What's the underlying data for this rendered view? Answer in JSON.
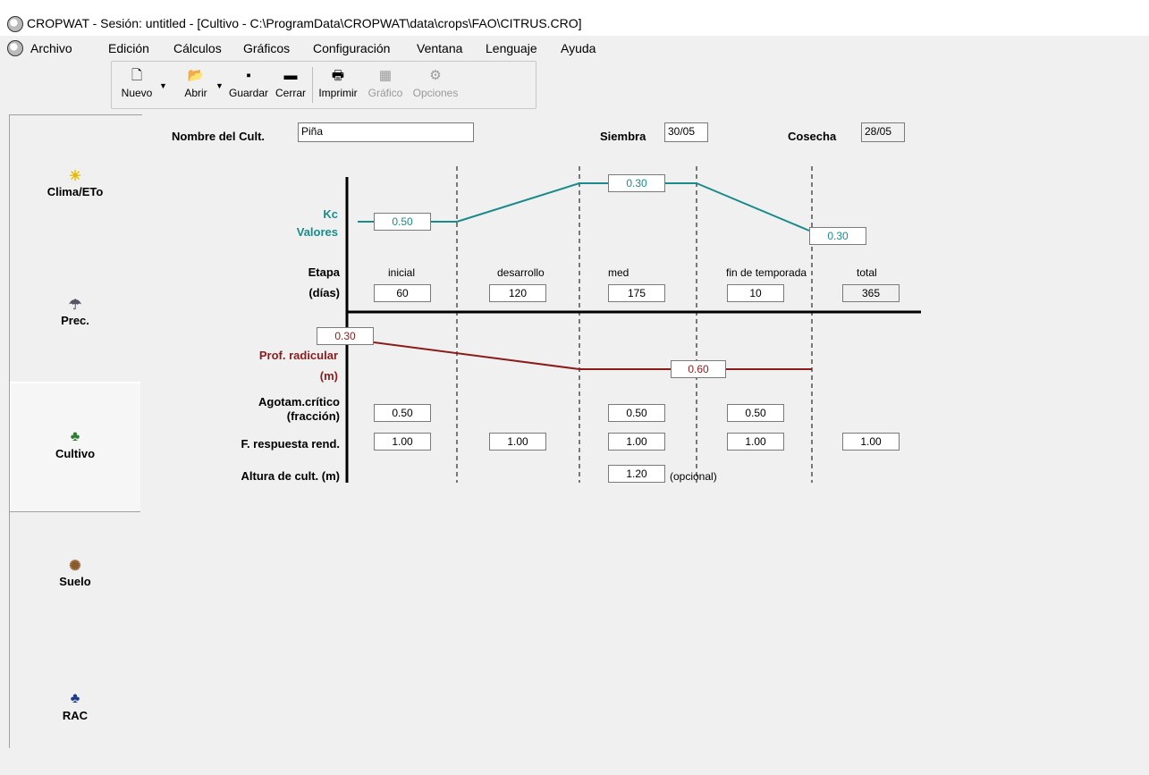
{
  "window": {
    "title": "CROPWAT - Sesión: untitled - [Cultivo - C:\\ProgramData\\CROPWAT\\data\\crops\\FAO\\CITRUS.CRO]"
  },
  "menu": [
    "Archivo",
    "Edición",
    "Cálculos",
    "Gráficos",
    "Configuración",
    "Ventana",
    "Lenguaje",
    "Ayuda"
  ],
  "toolbar": {
    "nuevo": "Nuevo",
    "abrir": "Abrir",
    "guardar": "Guardar",
    "cerrar": "Cerrar",
    "imprimir": "Imprimir",
    "grafico": "Gráfico",
    "opciones": "Opciones"
  },
  "sidebar": {
    "clima": "Clima/ETo",
    "prec": "Prec.",
    "cultivo": "Cultivo",
    "suelo": "Suelo",
    "rac": "RAC"
  },
  "crop": {
    "name_label": "Nombre del Cult.",
    "name_value": "Piña",
    "siembra_label": "Siembra",
    "siembra_value": "30/05",
    "cosecha_label": "Cosecha",
    "cosecha_value": "28/05"
  },
  "kc": {
    "label_1": "Kc",
    "label_2": "Valores",
    "initial": "0.50",
    "mid": "0.30",
    "end": "0.30"
  },
  "stages": {
    "label_1": "Etapa",
    "label_2": "(días)",
    "names": [
      "inicial",
      "desarrollo",
      "med",
      "fin de temporada",
      "total"
    ],
    "days": [
      "60",
      "120",
      "175",
      "10",
      "365"
    ]
  },
  "root": {
    "label_1": "Prof. radicular",
    "label_2": "(m)",
    "initial": "0.30",
    "max": "0.60"
  },
  "depletion": {
    "label_1": "Agotam.crítico",
    "label_2": "(fracción)",
    "values": [
      "0.50",
      "0.50",
      "0.50"
    ]
  },
  "yield_response": {
    "label": "F. respuesta rend.",
    "values": [
      "1.00",
      "1.00",
      "1.00",
      "1.00",
      "1.00"
    ]
  },
  "height": {
    "label": "Altura de cult. (m)",
    "value": "1.20",
    "note": "(opcional)"
  },
  "colors": {
    "kc_line": "#1b8a8a",
    "root_line": "#8b1c1c"
  }
}
